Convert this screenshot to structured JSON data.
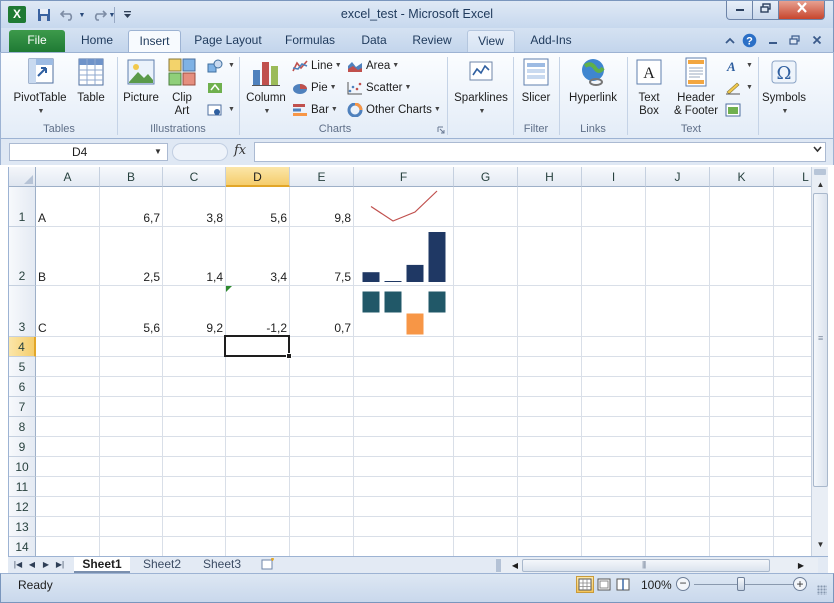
{
  "window": {
    "title": "excel_test - Microsoft Excel",
    "app_icon_letter": "X"
  },
  "ribbon_tabs": [
    {
      "label": "File"
    },
    {
      "label": "Home"
    },
    {
      "label": "Insert"
    },
    {
      "label": "Page Layout"
    },
    {
      "label": "Formulas"
    },
    {
      "label": "Data"
    },
    {
      "label": "Review"
    },
    {
      "label": "View"
    },
    {
      "label": "Add-Ins"
    }
  ],
  "ribbon": {
    "active_tab": "Insert",
    "groups": {
      "tables": {
        "label": "Tables",
        "pivottable": "PivotTable",
        "table": "Table"
      },
      "illustrations": {
        "label": "Illustrations",
        "picture": "Picture",
        "clipart_line1": "Clip",
        "clipart_line2": "Art"
      },
      "charts": {
        "label": "Charts",
        "column": "Column",
        "line": "Line",
        "pie": "Pie",
        "bar": "Bar",
        "area": "Area",
        "scatter": "Scatter",
        "other": "Other Charts"
      },
      "sparklines": {
        "label": "",
        "button": "Sparklines"
      },
      "filter": {
        "label": "Filter",
        "slicer": "Slicer"
      },
      "links": {
        "label": "Links",
        "hyperlink": "Hyperlink"
      },
      "text": {
        "label": "Text",
        "textbox_line1": "Text",
        "textbox_line2": "Box",
        "header_line1": "Header",
        "header_line2": "& Footer"
      },
      "symbols": {
        "label": "",
        "button": "Symbols"
      }
    }
  },
  "formula_bar": {
    "name_box": "D4",
    "fx_label": "fx",
    "formula": ""
  },
  "grid": {
    "columns": [
      "A",
      "B",
      "C",
      "D",
      "E",
      "F",
      "G",
      "H",
      "I",
      "J",
      "K",
      "L"
    ],
    "active_column": "D",
    "active_row": 4,
    "selected_cell": "D4",
    "rows": [
      {
        "num": "1",
        "cells": {
          "A": "A",
          "B": "6,7",
          "C": "3,8",
          "D": "5,6",
          "E": "9,8"
        }
      },
      {
        "num": "2",
        "cells": {
          "A": "B",
          "B": "2,5",
          "C": "1,4",
          "D": "3,4",
          "E": "7,5"
        }
      },
      {
        "num": "3",
        "cells": {
          "A": "C",
          "B": "5,6",
          "C": "9,2",
          "D": "-1,2",
          "E": "0,7"
        }
      },
      {
        "num": "4"
      },
      {
        "num": "5"
      },
      {
        "num": "6"
      },
      {
        "num": "7"
      },
      {
        "num": "8"
      },
      {
        "num": "9"
      },
      {
        "num": "10"
      },
      {
        "num": "11"
      },
      {
        "num": "12"
      },
      {
        "num": "13"
      },
      {
        "num": "14"
      }
    ]
  },
  "sparklines": {
    "row1": {
      "type": "line",
      "values": [
        6.7,
        3.8,
        5.6,
        9.8
      ],
      "color": "#c0504d"
    },
    "row2": {
      "type": "column",
      "values": [
        2.5,
        1.4,
        3.4,
        7.5
      ],
      "color": "#1f3864"
    },
    "row3": {
      "type": "winloss",
      "values": [
        5.6,
        9.2,
        -1.2,
        0.7
      ],
      "positive_color": "#215868",
      "negative_color": "#f79646"
    }
  },
  "sheets": {
    "tabs": [
      "Sheet1",
      "Sheet2",
      "Sheet3"
    ],
    "active": "Sheet1"
  },
  "status": {
    "ready": "Ready",
    "zoom": "100%"
  },
  "colors": {
    "file_tab": "#1f7a34",
    "active_header": "#f5cd6c",
    "ribbon_bg": "#e3ecf7"
  }
}
